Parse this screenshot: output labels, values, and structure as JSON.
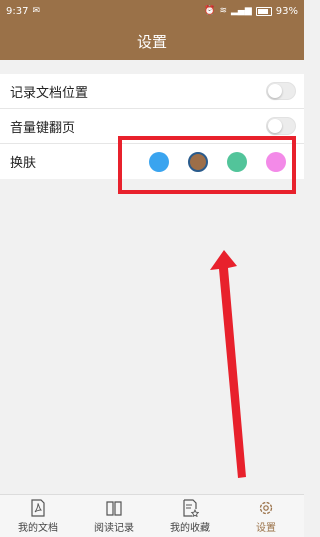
{
  "status_bar": {
    "time": "9:37",
    "battery": "93%"
  },
  "header": {
    "title": "设置"
  },
  "settings": {
    "rows": [
      {
        "label": "记录文档位置",
        "toggle_on": false
      },
      {
        "label": "音量键翻页",
        "toggle_on": false
      },
      {
        "label": "换肤"
      }
    ],
    "skins": [
      {
        "color": "#3aa4ef",
        "selected": false
      },
      {
        "color": "#9d6e48",
        "selected": true
      },
      {
        "color": "#52c49a",
        "selected": false
      },
      {
        "color": "#f38ae8",
        "selected": false
      }
    ]
  },
  "annotation": {
    "color": "#e8212c"
  },
  "tabbar": {
    "tabs": [
      {
        "label": "我的文档",
        "icon": "pdf-document-icon"
      },
      {
        "label": "阅读记录",
        "icon": "open-book-icon"
      },
      {
        "label": "我的收藏",
        "icon": "favorites-document-icon"
      },
      {
        "label": "设置",
        "icon": "gear-icon",
        "active": true
      }
    ]
  }
}
